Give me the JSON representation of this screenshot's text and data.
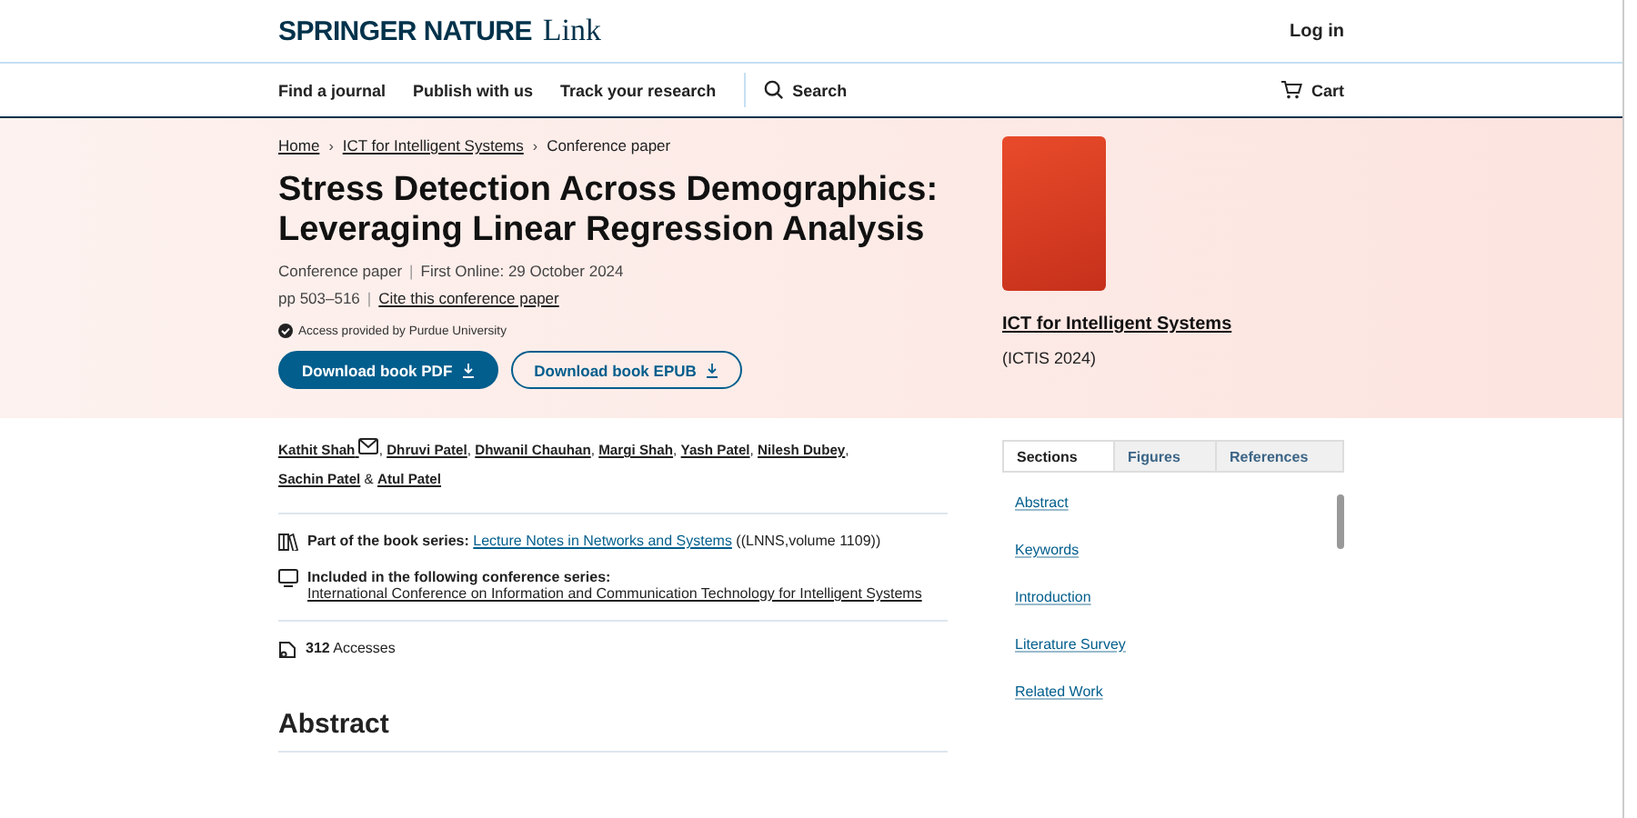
{
  "header": {
    "logo_main": "SPRINGER NATURE",
    "logo_sub": "Link",
    "login": "Log in"
  },
  "nav": {
    "items": [
      "Find a journal",
      "Publish with us",
      "Track your research"
    ],
    "search": "Search",
    "cart": "Cart"
  },
  "breadcrumbs": [
    "Home",
    "ICT for Intelligent Systems",
    "Conference paper"
  ],
  "breadcrumb_separators": [
    "›",
    "›"
  ],
  "title": "Stress Detection Across Demographics: Leveraging Linear Regression Analysis",
  "meta": {
    "type": "Conference paper",
    "first_online": "First Online: 29 October 2024",
    "pages": "pp 503–516",
    "cite": "Cite this conference paper",
    "separators": [
      "|",
      "|"
    ]
  },
  "access": "Access provided by Purdue University",
  "buttons": [
    {
      "label": "Download book PDF",
      "kind": "primary"
    },
    {
      "label": "Download book EPUB",
      "kind": "secondary"
    }
  ],
  "book": {
    "title": "ICT for Intelligent Systems",
    "subtitle": "(ICTIS 2024)"
  },
  "authors": [
    {
      "name": "Kathit Shah",
      "email": true,
      "sep": ","
    },
    {
      "name": "Dhruvi Patel",
      "email": false,
      "sep": ","
    },
    {
      "name": "Dhwanil Chauhan",
      "email": false,
      "sep": ","
    },
    {
      "name": "Margi Shah",
      "email": false,
      "sep": ","
    },
    {
      "name": "Yash Patel",
      "email": false,
      "sep": ","
    },
    {
      "name": "Nilesh Dubey",
      "email": false,
      "sep": ","
    },
    {
      "name": "Sachin Patel",
      "email": false,
      "sep": "&"
    },
    {
      "name": "Atul Patel",
      "email": false
    }
  ],
  "series": {
    "label": "Part of the book series:",
    "link": "Lecture Notes in Networks and Systems",
    "suffix": "((LNNS,volume 1109))"
  },
  "conference": {
    "label": "Included in the following conference series:",
    "link": "International Conference on Information and Communication Technology for Intelligent Systems"
  },
  "accesses": {
    "count": "312",
    "label": "Accesses"
  },
  "abstract_heading": "Abstract",
  "toc": {
    "tabs": [
      {
        "label": "Sections",
        "selected": true
      },
      {
        "label": "Figures",
        "selected": false
      },
      {
        "label": "References",
        "selected": false
      }
    ],
    "items": [
      "Abstract",
      "Keywords",
      "Introduction",
      "Literature Survey",
      "Related Work"
    ]
  }
}
